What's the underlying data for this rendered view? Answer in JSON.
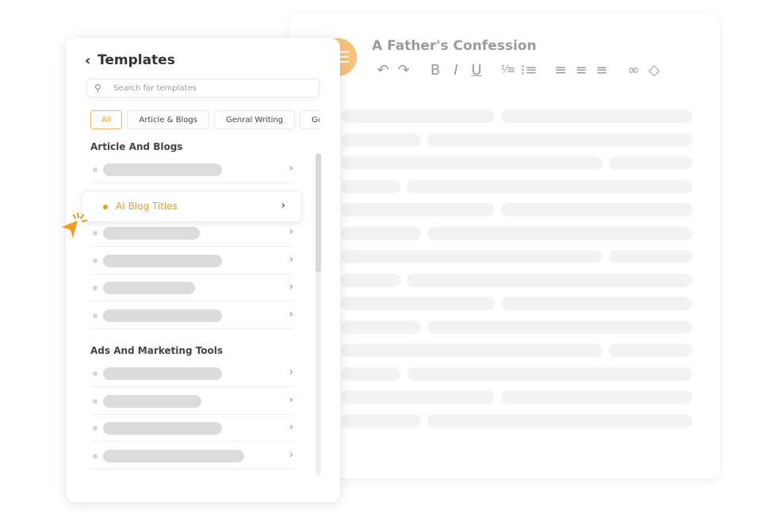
{
  "editor": {
    "title": "A Father's Confession",
    "avatar_icon": "menu-icon",
    "toolbar": [
      "undo-icon",
      "redo-icon",
      "bold-icon",
      "italic-icon",
      "underline-icon",
      "ordered-list-icon",
      "bullet-list-icon",
      "align-left-icon",
      "align-center-icon",
      "align-right-icon",
      "link-icon",
      "eraser-icon"
    ]
  },
  "panel": {
    "title": "Templates",
    "search_placeholder": "Search for templates",
    "chips": [
      "All",
      "Article & Blogs",
      "Genral Writing",
      "Goo"
    ],
    "active_chip": "All",
    "sections": [
      {
        "title": "Article And Blogs"
      },
      {
        "title": "Ads And Marketing Tools"
      }
    ],
    "highlighted_item": "AI Blog Titles"
  },
  "colors": {
    "accent": "#f39a23",
    "avatar": "#f9c27c"
  }
}
